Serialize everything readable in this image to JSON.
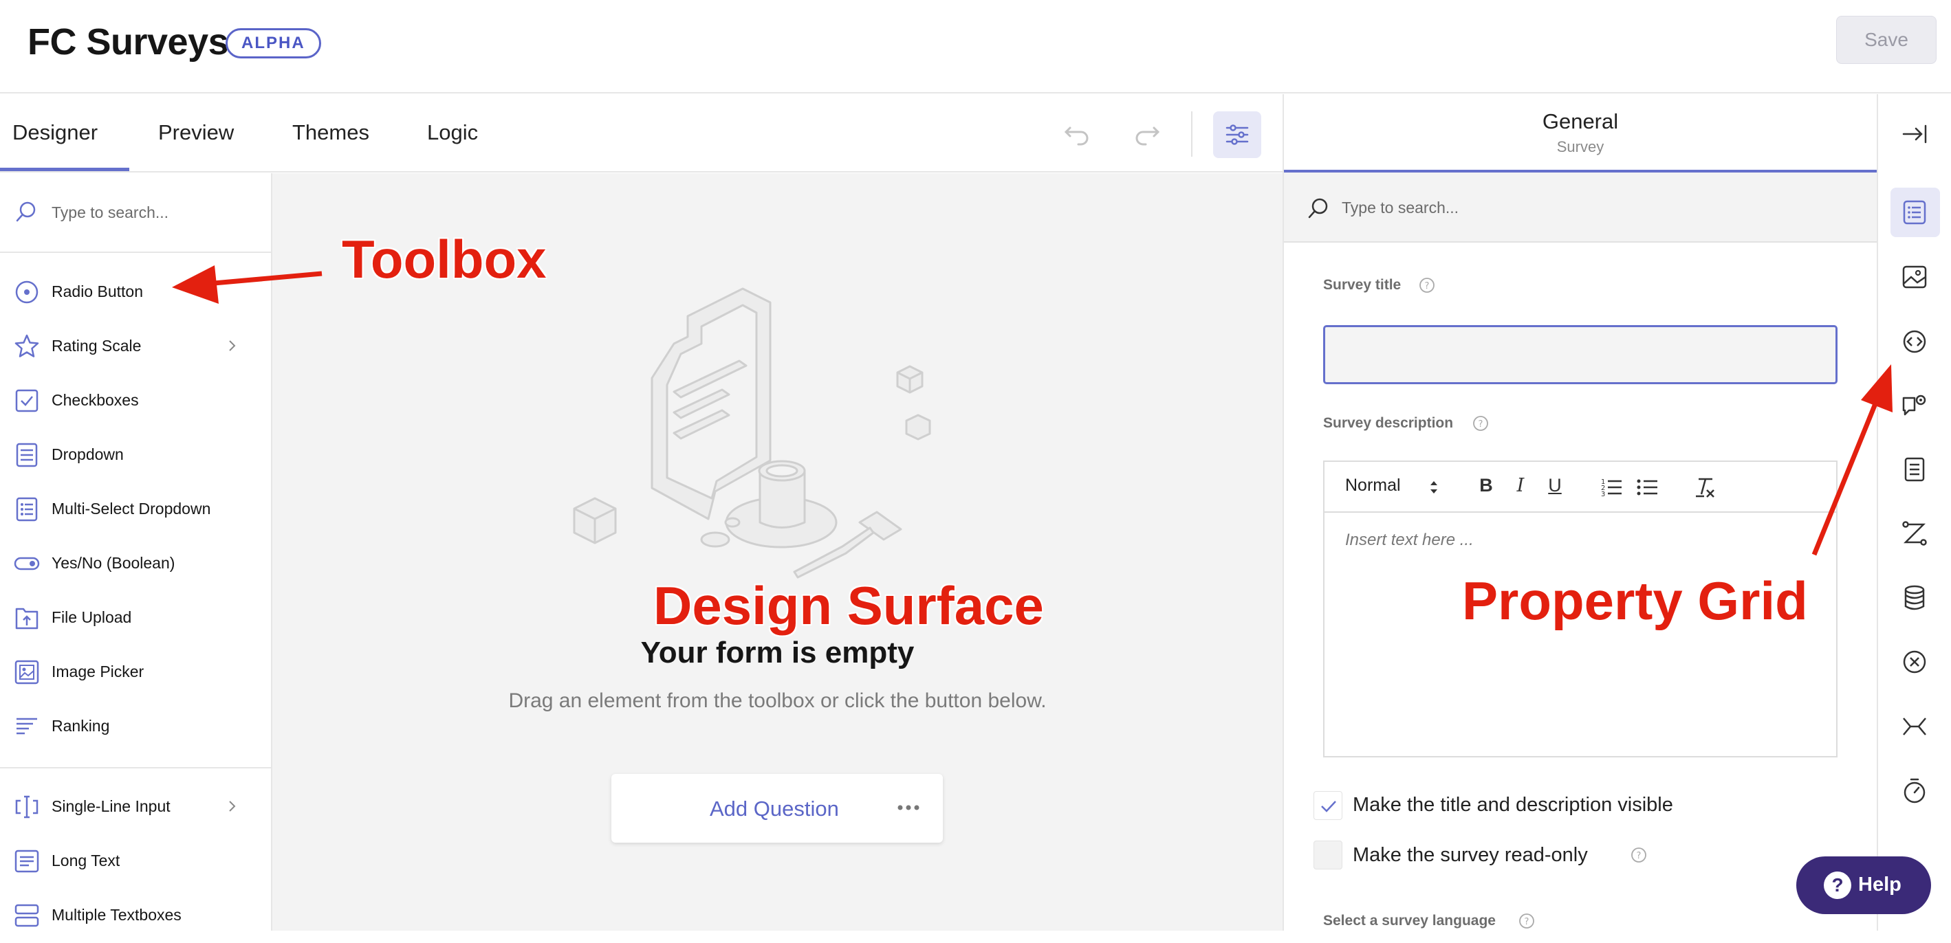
{
  "header": {
    "app_title": "FC Surveys",
    "badge": "ALPHA",
    "save_label": "Save"
  },
  "tabs": [
    {
      "label": "Designer",
      "active": true
    },
    {
      "label": "Preview",
      "active": false
    },
    {
      "label": "Themes",
      "active": false
    },
    {
      "label": "Logic",
      "active": false
    }
  ],
  "toolbar_icons": [
    "undo-icon",
    "redo-icon",
    "settings-sliders-icon"
  ],
  "toolbox": {
    "search_placeholder": "Type to search...",
    "items": [
      {
        "label": "Radio Button",
        "icon": "radio-icon"
      },
      {
        "label": "Rating Scale",
        "icon": "star-icon",
        "has_submenu": true
      },
      {
        "label": "Checkboxes",
        "icon": "checkbox-icon"
      },
      {
        "label": "Dropdown",
        "icon": "dropdown-icon"
      },
      {
        "label": "Multi-Select Dropdown",
        "icon": "multiselect-icon"
      },
      {
        "label": "Yes/No (Boolean)",
        "icon": "toggle-icon"
      },
      {
        "label": "File Upload",
        "icon": "file-upload-icon"
      },
      {
        "label": "Image Picker",
        "icon": "image-picker-icon"
      },
      {
        "label": "Ranking",
        "icon": "ranking-icon"
      },
      {
        "label": "Single-Line Input",
        "icon": "text-cursor-icon",
        "has_submenu": true
      },
      {
        "label": "Long Text",
        "icon": "long-text-icon"
      },
      {
        "label": "Multiple Textboxes",
        "icon": "multiple-textboxes-icon"
      }
    ]
  },
  "surface": {
    "empty_title": "Your form is empty",
    "empty_desc": "Drag an element from the toolbox or click the button below.",
    "add_question_label": "Add Question"
  },
  "property_grid": {
    "header_title": "General",
    "header_subtitle": "Survey",
    "search_placeholder": "Type to search...",
    "survey_title_label": "Survey title",
    "survey_title_value": "",
    "survey_description_label": "Survey description",
    "format_select": "Normal",
    "format_buttons": [
      "B",
      "I",
      "U"
    ],
    "description_placeholder": "Insert text here ...",
    "checkbox_visible_label": "Make the title and description visible",
    "checkbox_visible_checked": true,
    "checkbox_readonly_label": "Make the survey read-only",
    "checkbox_readonly_checked": false,
    "language_label": "Select a survey language"
  },
  "right_bar_icons": [
    "collapse-panel-icon",
    "general-list-icon",
    "image-icon",
    "navigation-icon",
    "question-settings-icon",
    "pages-icon",
    "logic-icon",
    "data-icon",
    "validation-icon",
    "pdf-icon",
    "timer-icon"
  ],
  "help_label": "Help",
  "annotations": {
    "toolbox": "Toolbox",
    "surface": "Design Surface",
    "property": "Property Grid"
  },
  "colors": {
    "accent": "#6570cc",
    "annotation": "#e3200f",
    "help_bg": "#3b2a78"
  }
}
